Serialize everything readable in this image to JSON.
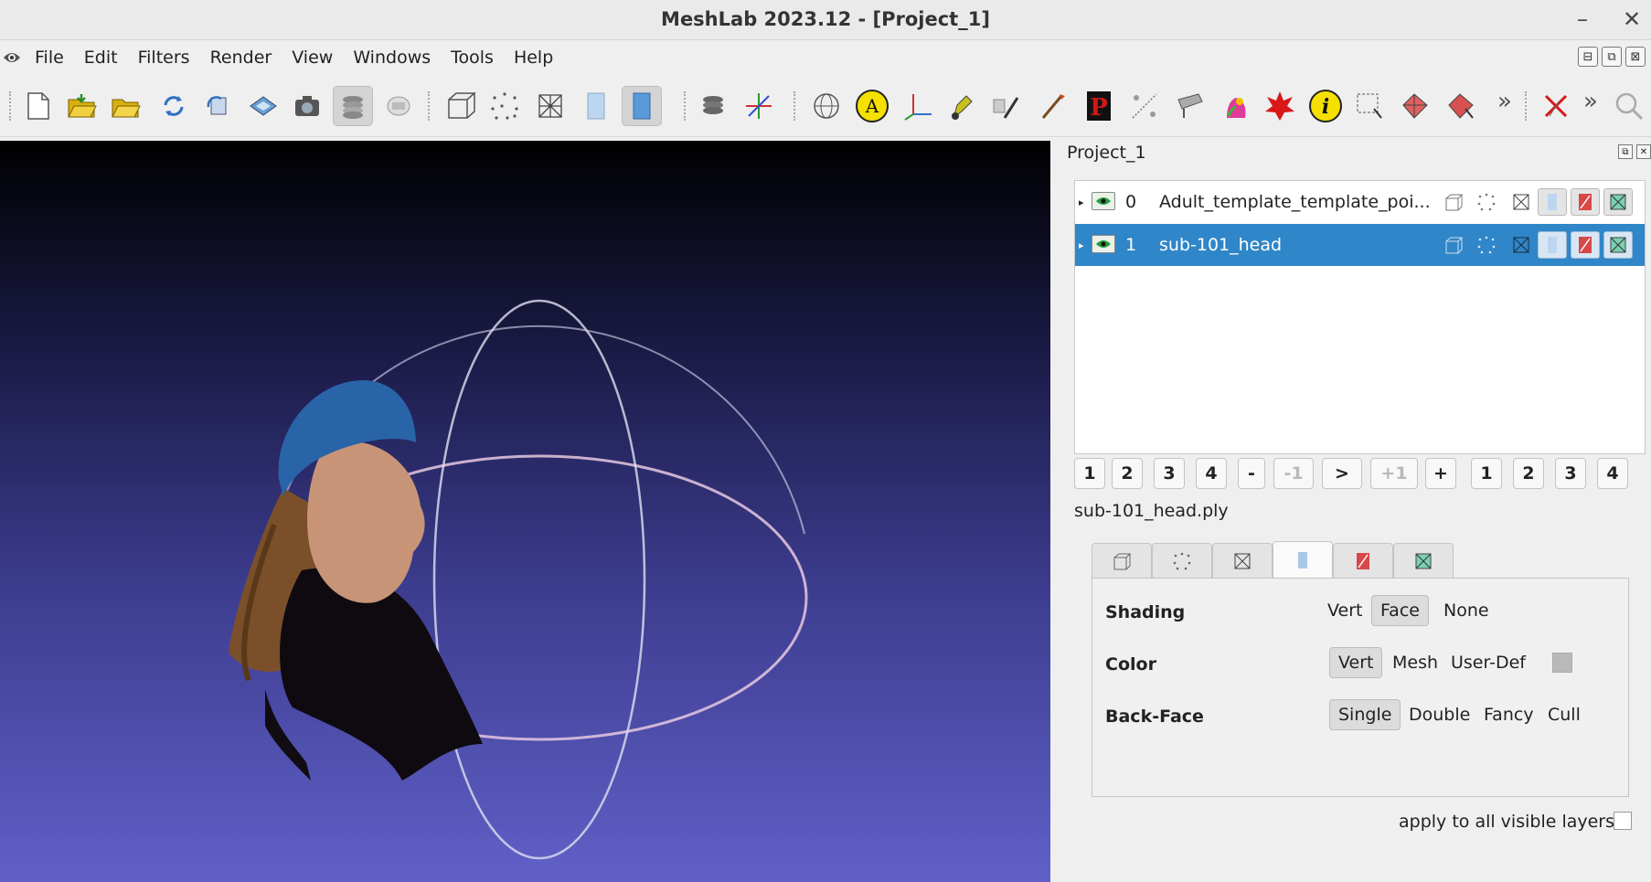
{
  "window": {
    "title": "MeshLab 2023.12 - [Project_1]",
    "minimize_glyph": "–",
    "close_glyph": "✕"
  },
  "menu": {
    "items": [
      "File",
      "Edit",
      "Filters",
      "Render",
      "View",
      "Windows",
      "Tools",
      "Help"
    ]
  },
  "mdi_buttons": [
    "⊟",
    "⧉",
    "⊠"
  ],
  "toolbar": {
    "icons": [
      "new-project-icon",
      "open-project-icon",
      "open-mesh-icon",
      "reload-icon",
      "reload-all-icon",
      "save-icon",
      "snapshot-icon",
      "layers-icon",
      "raster-icon",
      "bbox-icon",
      "points-icon",
      "wireframe-icon",
      "flat-lines-icon",
      "flat-icon",
      "layer-stack-icon",
      "axes-icon",
      "globe-icon",
      "annotation-icon",
      "axis-tool-icon",
      "paint-icon",
      "brush-icon",
      "pick-points-icon",
      "cut-icon",
      "measure-icon",
      "color-icon",
      "georef-icon",
      "info-icon",
      "select-vertices-icon",
      "select-faces-icon",
      "select-faces-alt-icon",
      "close-tool-icon",
      "zoom-icon"
    ],
    "more_glyph": "»"
  },
  "panel": {
    "title": "Project_1",
    "layers": [
      {
        "index": "0",
        "name": "Adult_template_template_poi...",
        "selected": false
      },
      {
        "index": "1",
        "name": "sub-101_head",
        "selected": true
      }
    ],
    "nav_buttons": [
      {
        "label": "1",
        "disabled": false
      },
      {
        "label": "2",
        "disabled": false
      },
      {
        "label": "3",
        "disabled": false
      },
      {
        "label": "4",
        "disabled": false
      },
      {
        "label": "-",
        "disabled": false
      },
      {
        "label": "-1",
        "disabled": true
      },
      {
        "label": ">",
        "disabled": false
      },
      {
        "label": "+1",
        "disabled": true
      },
      {
        "label": "+",
        "disabled": false
      },
      {
        "label": "1",
        "disabled": false
      },
      {
        "label": "2",
        "disabled": false
      },
      {
        "label": "3",
        "disabled": false
      },
      {
        "label": "4",
        "disabled": false
      }
    ],
    "filename": "sub-101_head.ply",
    "tabs": [
      "bbox-tab-icon",
      "points-tab-icon",
      "wireframe-tab-icon",
      "fill-tab-icon",
      "texture-tab-icon",
      "lines-tab-icon"
    ],
    "active_tab": 3,
    "shading": {
      "label": "Shading",
      "options": [
        "Vert",
        "Face",
        "None"
      ],
      "selected": "Face"
    },
    "color": {
      "label": "Color",
      "options": [
        "Vert",
        "Mesh",
        "User-Def"
      ],
      "selected": "Vert",
      "user_def_color": "#b9b9b9"
    },
    "backface": {
      "label": "Back-Face",
      "options": [
        "Single",
        "Double",
        "Fancy",
        "Cull"
      ],
      "selected": "Single"
    },
    "apply_label": "apply to all visible layers"
  },
  "colors": {
    "selection": "#2f86c8",
    "viewport_top": "#000000",
    "viewport_bottom": "#6060c8",
    "cap": "#2a64a8"
  }
}
